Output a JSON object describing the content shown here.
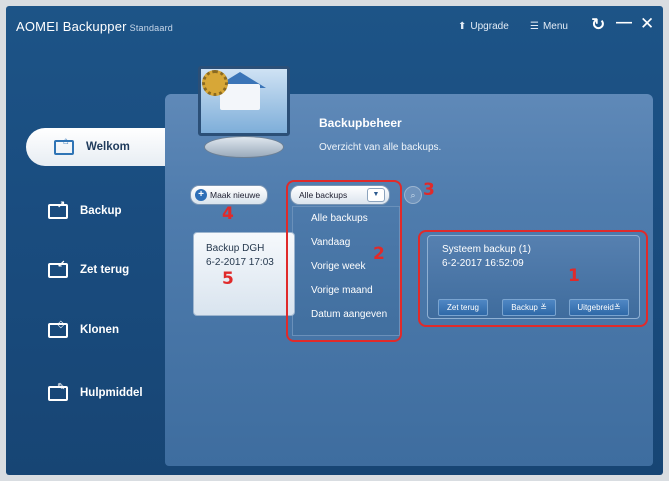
{
  "titlebar": {
    "app_name": "AOMEI Backupper",
    "edition": "Standaard",
    "upgrade_label": "Upgrade",
    "menu_label": "Menu",
    "upgrade_icon": "upgrade-arrow-icon",
    "menu_icon": "hamburger-icon"
  },
  "sidebar": {
    "items": [
      {
        "label": "Welkom",
        "icon": "home-monitor-icon",
        "active": true
      },
      {
        "label": "Backup",
        "icon": "backup-icon"
      },
      {
        "label": "Zet terug",
        "icon": "restore-icon"
      },
      {
        "label": "Klonen",
        "icon": "clone-icon"
      },
      {
        "label": "Hulpmiddel",
        "icon": "tools-icon"
      }
    ]
  },
  "header": {
    "title": "Backupbeheer",
    "subtitle": "Overzicht van alle backups."
  },
  "toolbar": {
    "new_label": "Maak nieuwe",
    "filter_value": "Alle backups"
  },
  "dropdown": {
    "options": [
      "Alle backups",
      "Vandaag",
      "Vorige week",
      "Vorige maand",
      "Datum aangeven"
    ]
  },
  "backups": [
    {
      "name": "Backup DGH",
      "date": "6-2-2017 17:03"
    },
    {
      "name": "Systeem backup (1)",
      "date": "6-2-2017 16:52:09",
      "actions": [
        "Zet terug",
        "Backup ≚",
        "Uitgebreid≚"
      ]
    }
  ],
  "annotations": [
    "1",
    "2",
    "3",
    "4",
    "5"
  ],
  "colors": {
    "accent": "#2e6fb7",
    "annotation": "#e02a2a",
    "window_bg": "#1d5487"
  }
}
